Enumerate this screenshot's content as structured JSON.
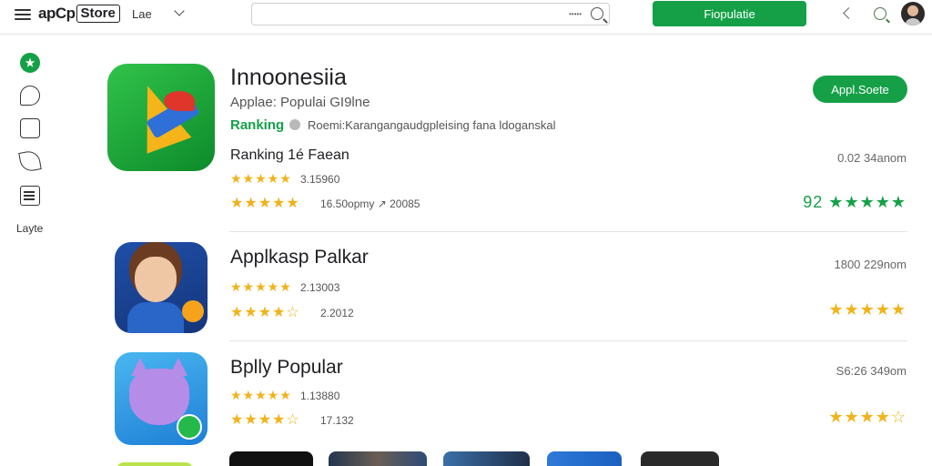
{
  "header": {
    "logo_part_a": "apCp",
    "logo_part_b": "Store",
    "language": "Lae",
    "search_value": "",
    "search_hint": "•••••",
    "popular_button": "Fiopulatie",
    "icons": [
      "menu-icon",
      "chevron-down-icon",
      "search-icon",
      "back-icon",
      "zoom-icon",
      "avatar"
    ]
  },
  "sidebar": {
    "items": [
      {
        "name": "home",
        "glyph": "★"
      },
      {
        "name": "chat"
      },
      {
        "name": "apps"
      },
      {
        "name": "leaf"
      },
      {
        "name": "news"
      }
    ],
    "label": "Layte"
  },
  "featured": {
    "title": "Innoonesiia",
    "subtitle": "Applae: Populai GI9lne",
    "rank_label": "Ranking",
    "rank_detail": "Roemi:Karangangaudgpleising fana ldoganskal",
    "ranking_line": "Ranking 1é Faean",
    "stars_1": "★★★★★",
    "rating_1": "3.15960",
    "stars_2": "★★★★★",
    "meta_2": "16.50opmy  ↗  20085",
    "button": "Appl.Soete",
    "right_meta": "0.02 34anom",
    "right_stars": "92 ★★★★★"
  },
  "apps": [
    {
      "title": "Applkasp Palkar",
      "stars_1": "★★★★★",
      "rating_1": "2.13003",
      "stars_2": "★★★★☆",
      "rating_2": "2.2012",
      "right_meta": "1800 229nom",
      "right_stars": "★★★★★"
    },
    {
      "title": "Bplly Popular",
      "stars_1": "★★★★★",
      "rating_1": "1.13880",
      "stars_2": "★★★★☆",
      "rating_2": "17.132",
      "right_meta": "S6:26 349om",
      "right_stars": "★★★★☆"
    }
  ],
  "colors": {
    "accent": "#15a047",
    "star": "#f2b21b"
  }
}
